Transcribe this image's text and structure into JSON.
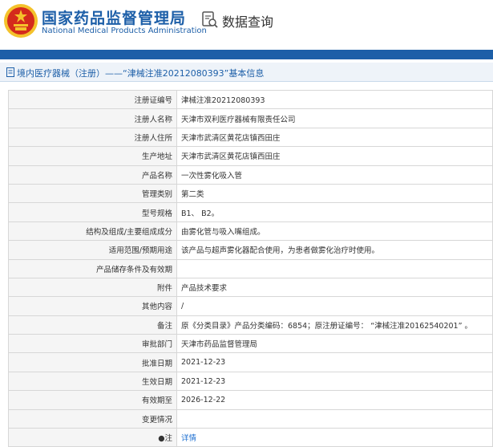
{
  "header": {
    "brand_cn": "国家药品监督管理局",
    "brand_en": "National Medical Products Administration",
    "query_title": "数据查询",
    "emblem_icon": "national-emblem-icon",
    "query_icon": "search-document-icon"
  },
  "section": {
    "title": "境内医疗器械（注册）——“津械注准20212080393”基本信息"
  },
  "rows": [
    {
      "label": "注册证编号",
      "value": "津械注准20212080393"
    },
    {
      "label": "注册人名称",
      "value": "天津市双利医疗器械有限责任公司"
    },
    {
      "label": "注册人住所",
      "value": "天津市武清区黄花店镇西田庄"
    },
    {
      "label": "生产地址",
      "value": "天津市武清区黄花店镇西田庄"
    },
    {
      "label": "产品名称",
      "value": "一次性雾化吸入管"
    },
    {
      "label": "管理类别",
      "value": "第二类"
    },
    {
      "label": "型号规格",
      "value": "B1、 B2。"
    },
    {
      "label": "结构及组成/主要组成成分",
      "value": "由雾化管与吸入嘴组成。"
    },
    {
      "label": "适用范围/预期用途",
      "value": "该产品与超声雾化器配合使用，为患者做雾化治疗时使用。"
    },
    {
      "label": "产品储存条件及有效期",
      "value": ""
    },
    {
      "label": "附件",
      "value": "产品技术要求"
    },
    {
      "label": "其他内容",
      "value": "/"
    },
    {
      "label": "备注",
      "value": "原《分类目录》产品分类编码：6854；原注册证编号： “津械注准20162540201” 。"
    },
    {
      "label": "审批部门",
      "value": "天津市药品监督管理局"
    },
    {
      "label": "批准日期",
      "value": "2021-12-23"
    },
    {
      "label": "生效日期",
      "value": "2021-12-23"
    },
    {
      "label": "有效期至",
      "value": "2026-12-22"
    },
    {
      "label": "变更情况",
      "value": ""
    }
  ],
  "note_row": {
    "label": "●注",
    "link": "详情"
  },
  "colors": {
    "brand_blue": "#1d5fa8",
    "emblem_red": "#d42a1c",
    "emblem_gold": "#f4c22b",
    "link_blue": "#1d6fd0"
  }
}
